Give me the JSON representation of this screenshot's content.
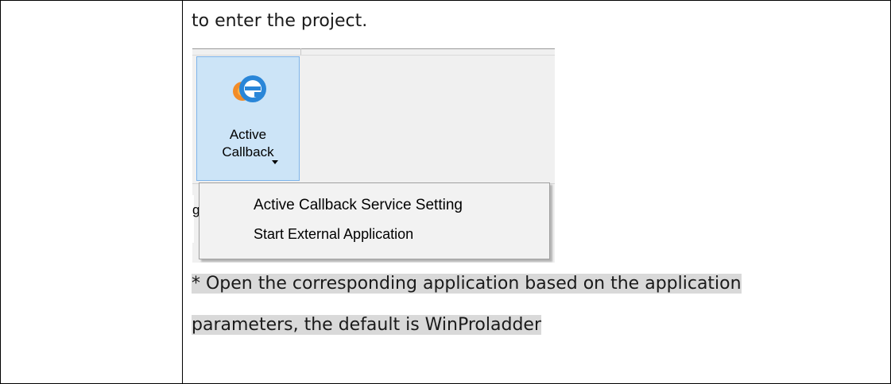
{
  "intro_text": "to enter the project.",
  "ribbon": {
    "button_label_line1": "Active",
    "button_label_line2": "Callback",
    "icon": "internet-explorer-icon",
    "highlight_color": "#cce4f7"
  },
  "dropdown": {
    "items": [
      {
        "label": "Active Callback Service Setting"
      },
      {
        "label": "Start External Application"
      }
    ]
  },
  "stray_char": "g",
  "note": {
    "line1": "* Open the corresponding application based on the application",
    "line2": "parameters, the default is WinProladder",
    "highlight_color": "#d9d9d9"
  }
}
